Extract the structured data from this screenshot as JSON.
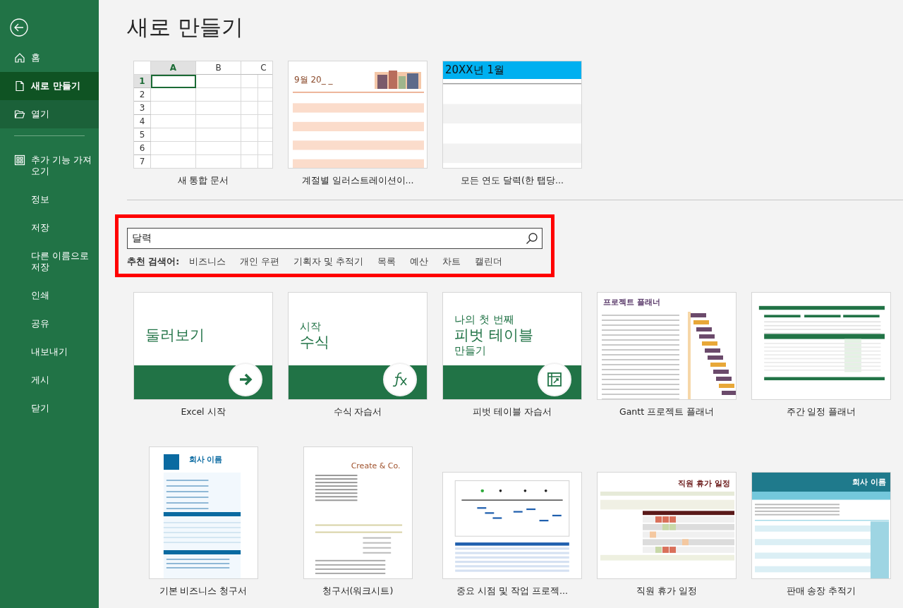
{
  "sidebar": {
    "items": [
      {
        "kind": "home",
        "label": "홈",
        "selected": false,
        "hovered": false
      },
      {
        "kind": "document",
        "label": "새로 만들기",
        "selected": true,
        "hovered": false
      },
      {
        "kind": "folder",
        "label": "열기",
        "selected": false,
        "hovered": true
      }
    ],
    "more_items": [
      {
        "kind": "addins",
        "label": "추가 기능 가져오기",
        "selected": false,
        "hovered": false
      },
      {
        "kind": "plain",
        "label": "정보",
        "selected": false,
        "hovered": false
      },
      {
        "kind": "plain",
        "label": "저장",
        "selected": false,
        "hovered": false
      },
      {
        "kind": "plain",
        "label": "다른 이름으로 저장",
        "selected": false,
        "hovered": false
      },
      {
        "kind": "plain",
        "label": "인쇄",
        "selected": false,
        "hovered": false
      },
      {
        "kind": "plain",
        "label": "공유",
        "selected": false,
        "hovered": false
      },
      {
        "kind": "plain",
        "label": "내보내기",
        "selected": false,
        "hovered": false
      },
      {
        "kind": "plain",
        "label": "게시",
        "selected": false,
        "hovered": false
      },
      {
        "kind": "plain",
        "label": "닫기",
        "selected": false,
        "hovered": false
      }
    ]
  },
  "title": "새로 만들기",
  "featured": [
    {
      "kind": "sheet",
      "name": "새 통합 문서",
      "columns": [
        {
          "label": "A",
          "selected": true
        },
        {
          "label": "B",
          "selected": false
        },
        {
          "label": "C",
          "selected": false
        }
      ],
      "rows": [
        {
          "label": "1",
          "selected": true
        },
        {
          "label": "2",
          "selected": false
        },
        {
          "label": "3",
          "selected": false
        },
        {
          "label": "4",
          "selected": false
        },
        {
          "label": "5",
          "selected": false
        },
        {
          "label": "6",
          "selected": false
        },
        {
          "label": "7",
          "selected": false
        }
      ]
    },
    {
      "kind": "calendar_illustrated",
      "name": "계절별 일러스트레이션이...",
      "heading": "9월 20_ _"
    },
    {
      "kind": "calendar_blue",
      "name": "모든 연도 달력(한 탭당...",
      "heading": "20XX년 1월"
    }
  ],
  "search": {
    "value": "달력",
    "suggestions_label": "추천 검색어:",
    "suggestions": [
      "비즈니스",
      "개인 우편",
      "기획자 및 추적기",
      "목록",
      "예산",
      "차트",
      "캘린더"
    ]
  },
  "templates": [
    {
      "kind": "tour",
      "name": "Excel 시작",
      "lines": [
        {
          "kind": "main",
          "text": "둘러보기"
        }
      ]
    },
    {
      "kind": "formula_tour",
      "name": "수식 자습서",
      "lines": [
        {
          "kind": "lead",
          "text": "시작"
        },
        {
          "kind": "main",
          "text": "수식"
        }
      ]
    },
    {
      "kind": "pivot_tour",
      "name": "피벗 테이블 자습서",
      "lines": [
        {
          "kind": "lead",
          "text": "나의 첫 번째"
        },
        {
          "kind": "main",
          "text": "피벗 테이블"
        },
        {
          "kind": "lead",
          "text": "만들기"
        }
      ]
    },
    {
      "kind": "gantt",
      "name": "Gantt 프로젝트 플래너",
      "heading": "프로젝트 플래너"
    },
    {
      "kind": "weekly",
      "name": "주간 일정 플래너"
    },
    {
      "kind": "invoice_blue",
      "name": "기본 비즈니스 청구서",
      "heading": "회사 이름"
    },
    {
      "kind": "invoice_co",
      "name": "청구서(워크시트)",
      "heading": "Create & Co."
    },
    {
      "kind": "milestone",
      "name": "중요 시점 및 작업 프로젝..."
    },
    {
      "kind": "vacation",
      "name": "직원 휴가 일정",
      "heading": "직원 휴가 일정"
    },
    {
      "kind": "sales",
      "name": "판매 송장 추적기",
      "heading": "회사 이름"
    }
  ]
}
